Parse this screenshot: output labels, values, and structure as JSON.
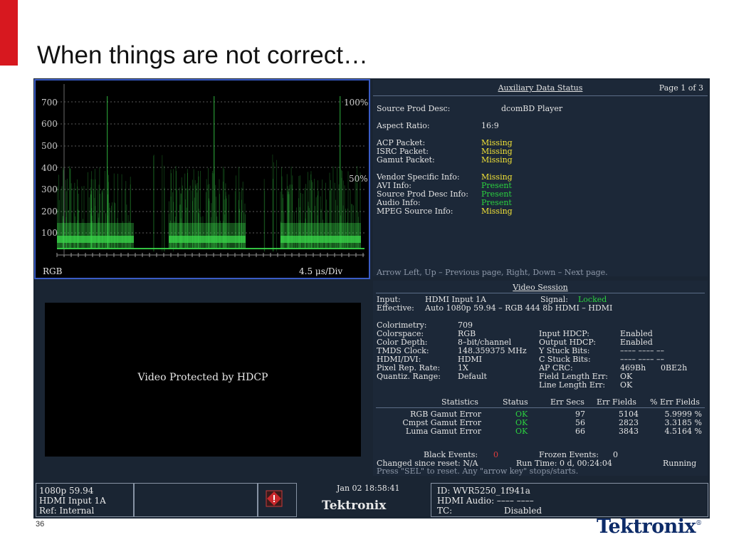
{
  "slide": {
    "title": "When things are not correct…",
    "page_number": "36",
    "logo": "Tektronix"
  },
  "waveform": {
    "scale_labels": [
      "700",
      "600",
      "500",
      "400",
      "300",
      "200",
      "100"
    ],
    "pct_top": "100%",
    "pct_mid": "50%",
    "mode": "RGB",
    "timebase": "4.5 μs/Div"
  },
  "aux": {
    "title": "Auxiliary Data Status",
    "page": "Page 1 of 3",
    "source_prod_desc_label": "Source Prod Desc:",
    "source_prod_desc_value": "dcomBD Player",
    "aspect_label": "Aspect Ratio:",
    "aspect_value": "16:9",
    "items": [
      {
        "label": "ACP Packet:",
        "value": "Missing",
        "status": "missing"
      },
      {
        "label": "ISRC Packet:",
        "value": "Missing",
        "status": "missing"
      },
      {
        "label": "Gamut Packet:",
        "value": "Missing",
        "status": "missing"
      },
      {
        "label": "Vendor Specific Info:",
        "value": "Missing",
        "status": "missing"
      },
      {
        "label": "AVI Info:",
        "value": "Present",
        "status": "present"
      },
      {
        "label": "Source Prod Desc Info:",
        "value": "Present",
        "status": "present"
      },
      {
        "label": "Audio Info:",
        "value": "Present",
        "status": "present"
      },
      {
        "label": "MPEG Source Info:",
        "value": "Missing",
        "status": "missing"
      }
    ],
    "footer": "Arrow Left, Up – Previous page, Right, Down – Next page."
  },
  "video": {
    "message": "Video Protected by HDCP"
  },
  "session": {
    "title": "Video Session",
    "input_label": "Input:",
    "input_value": "HDMI Input 1A",
    "signal_label": "Signal:",
    "signal_value": "Locked",
    "effective_label": "Effective:",
    "effective_value": "Auto 1080p 59.94 – RGB 444 8b HDMI – HDMI",
    "left_params": [
      {
        "label": "Colorimetry:",
        "value": "709"
      },
      {
        "label": "Colorspace:",
        "value": "RGB"
      },
      {
        "label": "Color Depth:",
        "value": "8–bit/channel"
      },
      {
        "label": "TMDS Clock:",
        "value": "148.359375 MHz"
      },
      {
        "label": "HDMI/DVI:",
        "value": "HDMI"
      },
      {
        "label": "Pixel Rep. Rate:",
        "value": "1X"
      },
      {
        "label": "Quantiz. Range:",
        "value": "Default"
      }
    ],
    "right_params": [
      {
        "label": "Input HDCP:",
        "value": "Enabled",
        "value2": ""
      },
      {
        "label": "Output HDCP:",
        "value": "Enabled",
        "value2": ""
      },
      {
        "label": "Y Stuck Bits:",
        "value": "–––– –––– ––",
        "value2": ""
      },
      {
        "label": "C Stuck Bits:",
        "value": "–––– –––– ––",
        "value2": ""
      },
      {
        "label": "AP CRC:",
        "value": "469Bh",
        "value2": "0BE2h"
      },
      {
        "label": "Field Length Err:",
        "value": "OK",
        "value2": ""
      },
      {
        "label": "Line Length Err:",
        "value": "OK",
        "value2": ""
      }
    ],
    "stats_headers": [
      "Statistics",
      "Status",
      "Err Secs",
      "Err Fields",
      "% Err Fields"
    ],
    "stats_rows": [
      {
        "name": "RGB Gamut Error",
        "status": "OK",
        "err_secs": "97",
        "err_fields": "5104",
        "pct": "5.9999 %"
      },
      {
        "name": "Cmpst Gamut Error",
        "status": "OK",
        "err_secs": "56",
        "err_fields": "2823",
        "pct": "3.3185 %"
      },
      {
        "name": "Luma Gamut Error",
        "status": "OK",
        "err_secs": "66",
        "err_fields": "3843",
        "pct": "4.5164 %"
      }
    ],
    "black_events_label": "Black Events:",
    "black_events_value": "0",
    "frozen_events_label": "Frozen Events:",
    "frozen_events_value": "0",
    "changed_label": "Changed since reset: N/A",
    "run_time": "Run Time: 0 d, 00:24:04",
    "running": "Running",
    "reset_hint": "Press \"SEL\" to reset.   Any \"arrow key\" stops/starts."
  },
  "status_bar": {
    "format": "1080p 59.94",
    "input": "HDMI Input 1A",
    "ref": "Ref: Internal",
    "datetime": "Jan 02 18:58:41",
    "brand": "Tektronix",
    "id": "ID: WVR5250_1f941a",
    "hdmi_audio": "HDMI Audio: –––– ––––",
    "tc_label": "TC:",
    "tc_value": "Disabled"
  },
  "colors": {
    "brand_red": "#d7181f",
    "trace_green": "#39d64a",
    "missing_yellow": "#f2e337",
    "present_green": "#2bd13f",
    "panel_bg": "#1c2838",
    "highlight_border": "#3a5cc5"
  },
  "icons": {
    "warning": "warning-diamond-icon"
  }
}
